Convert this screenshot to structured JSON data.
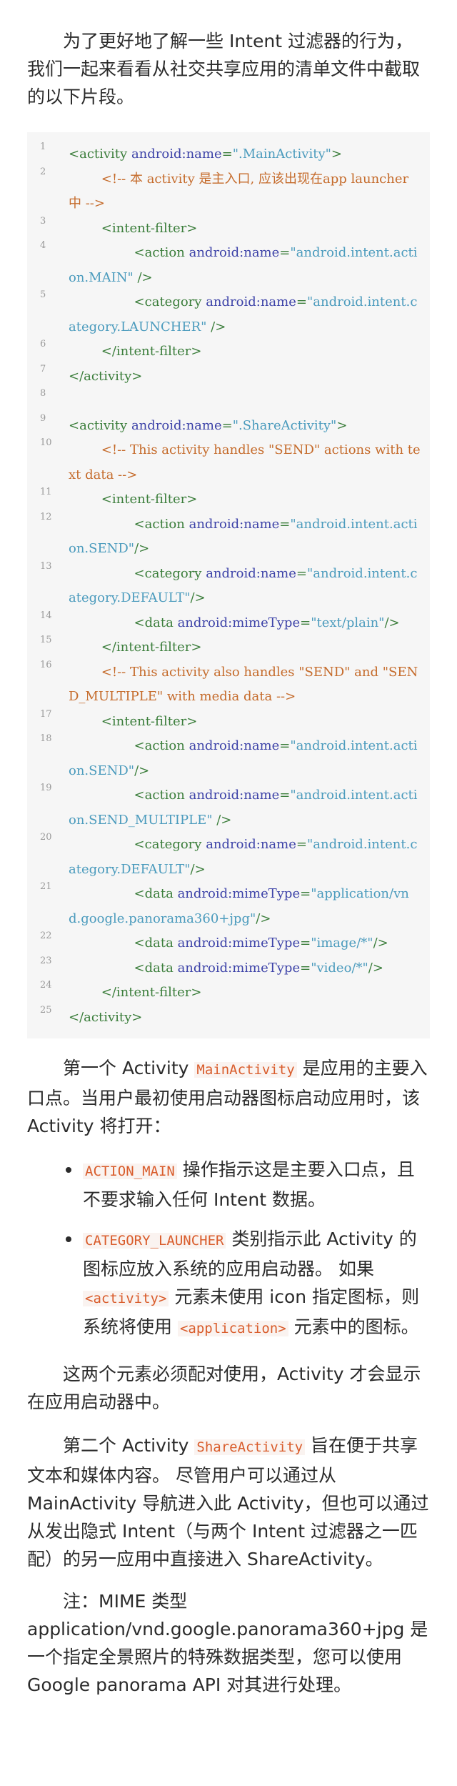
{
  "intro": "为了更好地了解一些 Intent 过滤器的行为，我们一起来看看从社交共享应用的清单文件中截取的以下片段。",
  "code_lines": [
    {
      "n": "1",
      "segs": [
        {
          "t": "<activity ",
          "c": "tg"
        },
        {
          "t": "android:name",
          "c": "at"
        },
        {
          "t": "=",
          "c": "tg"
        },
        {
          "t": "\".MainActivity\"",
          "c": "sv"
        },
        {
          "t": ">",
          "c": "tg"
        }
      ]
    },
    {
      "n": "2",
      "segs": [
        {
          "t": "        "
        },
        {
          "t": "<!-- 本 activity 是主入口, 应该出现在app launcher中 -->",
          "c": "cm"
        }
      ]
    },
    {
      "n": "3",
      "segs": [
        {
          "t": "        "
        },
        {
          "t": "<intent-filter>",
          "c": "tg"
        }
      ]
    },
    {
      "n": "4",
      "segs": [
        {
          "t": "                "
        },
        {
          "t": "<action ",
          "c": "tg"
        },
        {
          "t": "android:name",
          "c": "at"
        },
        {
          "t": "=",
          "c": "tg"
        },
        {
          "t": "\"android.intent.action.MAIN\"",
          "c": "sv"
        },
        {
          "t": " />",
          "c": "tg"
        }
      ]
    },
    {
      "n": "5",
      "segs": [
        {
          "t": "                "
        },
        {
          "t": "<category ",
          "c": "tg"
        },
        {
          "t": "android:name",
          "c": "at"
        },
        {
          "t": "=",
          "c": "tg"
        },
        {
          "t": "\"android.intent.category.LAUNCHER\"",
          "c": "sv"
        },
        {
          "t": " />",
          "c": "tg"
        }
      ]
    },
    {
      "n": "6",
      "segs": [
        {
          "t": "        "
        },
        {
          "t": "</intent-filter>",
          "c": "tg"
        }
      ]
    },
    {
      "n": "7",
      "segs": [
        {
          "t": "</activity>",
          "c": "tg"
        }
      ]
    },
    {
      "n": "8",
      "segs": [
        {
          "t": " "
        }
      ]
    },
    {
      "n": "9",
      "segs": [
        {
          "t": "<activity ",
          "c": "tg"
        },
        {
          "t": "android:name",
          "c": "at"
        },
        {
          "t": "=",
          "c": "tg"
        },
        {
          "t": "\".ShareActivity\"",
          "c": "sv"
        },
        {
          "t": ">",
          "c": "tg"
        }
      ]
    },
    {
      "n": "10",
      "segs": [
        {
          "t": "        "
        },
        {
          "t": "<!-- This activity handles \"SEND\" actions with text data -->",
          "c": "cm"
        }
      ]
    },
    {
      "n": "11",
      "segs": [
        {
          "t": "        "
        },
        {
          "t": "<intent-filter>",
          "c": "tg"
        }
      ]
    },
    {
      "n": "12",
      "segs": [
        {
          "t": "                "
        },
        {
          "t": "<action ",
          "c": "tg"
        },
        {
          "t": "android:name",
          "c": "at"
        },
        {
          "t": "=",
          "c": "tg"
        },
        {
          "t": "\"android.intent.action.SEND\"",
          "c": "sv"
        },
        {
          "t": "/>",
          "c": "tg"
        }
      ]
    },
    {
      "n": "13",
      "segs": [
        {
          "t": "                "
        },
        {
          "t": "<category ",
          "c": "tg"
        },
        {
          "t": "android:name",
          "c": "at"
        },
        {
          "t": "=",
          "c": "tg"
        },
        {
          "t": "\"android.intent.category.DEFAULT\"",
          "c": "sv"
        },
        {
          "t": "/>",
          "c": "tg"
        }
      ]
    },
    {
      "n": "14",
      "segs": [
        {
          "t": "                "
        },
        {
          "t": "<data ",
          "c": "tg"
        },
        {
          "t": "android:mimeType",
          "c": "at"
        },
        {
          "t": "=",
          "c": "tg"
        },
        {
          "t": "\"text/plain\"",
          "c": "sv"
        },
        {
          "t": "/>",
          "c": "tg"
        }
      ]
    },
    {
      "n": "15",
      "segs": [
        {
          "t": "        "
        },
        {
          "t": "</intent-filter>",
          "c": "tg"
        }
      ]
    },
    {
      "n": "16",
      "segs": [
        {
          "t": "        "
        },
        {
          "t": "<!-- This activity also handles \"SEND\" and \"SEND_MULTIPLE\" with media data -->",
          "c": "cm"
        }
      ]
    },
    {
      "n": "17",
      "segs": [
        {
          "t": "        "
        },
        {
          "t": "<intent-filter>",
          "c": "tg"
        }
      ]
    },
    {
      "n": "18",
      "segs": [
        {
          "t": "                "
        },
        {
          "t": "<action ",
          "c": "tg"
        },
        {
          "t": "android:name",
          "c": "at"
        },
        {
          "t": "=",
          "c": "tg"
        },
        {
          "t": "\"android.intent.action.SEND\"",
          "c": "sv"
        },
        {
          "t": "/>",
          "c": "tg"
        }
      ]
    },
    {
      "n": "19",
      "segs": [
        {
          "t": "                "
        },
        {
          "t": "<action ",
          "c": "tg"
        },
        {
          "t": "android:name",
          "c": "at"
        },
        {
          "t": "=",
          "c": "tg"
        },
        {
          "t": "\"android.intent.action.SEND_MULTIPLE\"",
          "c": "sv"
        },
        {
          "t": " />",
          "c": "tg"
        }
      ]
    },
    {
      "n": "20",
      "segs": [
        {
          "t": "                "
        },
        {
          "t": "<category ",
          "c": "tg"
        },
        {
          "t": "android:name",
          "c": "at"
        },
        {
          "t": "=",
          "c": "tg"
        },
        {
          "t": "\"android.intent.category.DEFAULT\"",
          "c": "sv"
        },
        {
          "t": "/>",
          "c": "tg"
        }
      ]
    },
    {
      "n": "21",
      "segs": [
        {
          "t": "                "
        },
        {
          "t": "<data ",
          "c": "tg"
        },
        {
          "t": "android:mimeType",
          "c": "at"
        },
        {
          "t": "=",
          "c": "tg"
        },
        {
          "t": "\"application/vnd.google.panorama360+jpg\"",
          "c": "sv"
        },
        {
          "t": "/>",
          "c": "tg"
        }
      ]
    },
    {
      "n": "22",
      "segs": [
        {
          "t": "                "
        },
        {
          "t": "<data ",
          "c": "tg"
        },
        {
          "t": "android:mimeType",
          "c": "at"
        },
        {
          "t": "=",
          "c": "tg"
        },
        {
          "t": "\"image/*\"",
          "c": "sv"
        },
        {
          "t": "/>",
          "c": "tg"
        }
      ]
    },
    {
      "n": "23",
      "segs": [
        {
          "t": "                "
        },
        {
          "t": "<data ",
          "c": "tg"
        },
        {
          "t": "android:mimeType",
          "c": "at"
        },
        {
          "t": "=",
          "c": "tg"
        },
        {
          "t": "\"video/*\"",
          "c": "sv"
        },
        {
          "t": "/>",
          "c": "tg"
        }
      ]
    },
    {
      "n": "24",
      "segs": [
        {
          "t": "        "
        },
        {
          "t": "</intent-filter>",
          "c": "tg"
        }
      ]
    },
    {
      "n": "25",
      "segs": [
        {
          "t": "</activity>",
          "c": "tg"
        }
      ]
    }
  ],
  "p1": {
    "a": "第一个 Activity ",
    "code": "MainActivity",
    "b": " 是应用的主要入口点。当用户最初使用启动器图标启动应用时，该 Activity 将打开："
  },
  "bullets": [
    {
      "code": "ACTION_MAIN",
      "text": " 操作指示这是主要入口点，且不要求输入任何 Intent 数据。"
    },
    {
      "code": "CATEGORY_LAUNCHER",
      "text": " 类别指示此 Activity 的图标应放入系统的应用启动器。 如果 ",
      "code2": "<activity>",
      "text2": " 元素未使用 icon 指定图标，则系统将使用 ",
      "code3": "<application>",
      "text3": " 元素中的图标。"
    }
  ],
  "p2": "这两个元素必须配对使用，Activity 才会显示在应用启动器中。",
  "p3": {
    "a": "第二个 Activity ",
    "code": "ShareActivity",
    "b": " 旨在便于共享文本和媒体内容。 尽管用户可以通过从 MainActivity 导航进入此 Activity，但也可以通过从发出隐式 Intent（与两个 Intent 过滤器之一匹配）的另一应用中直接进入 ShareActivity。"
  },
  "p4": "注：MIME 类型 application/vnd.google.panorama360+jpg 是一个指定全景照片的特殊数据类型，您可以使用 Google panorama API 对其进行处理。",
  "colors": {
    "tag": "#3a7d3a",
    "attr": "#3d43a8",
    "string": "#4b9bbd",
    "comment": "#c56b2b",
    "inline_code": "#d95c2b",
    "code_bg": "#f6f6f6"
  }
}
